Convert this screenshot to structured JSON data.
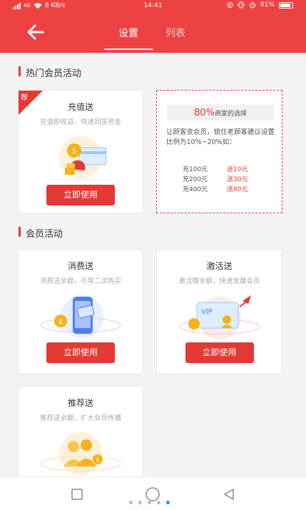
{
  "status_bar": {
    "signal": "4G",
    "speed": "8 KB/s",
    "time": "14:41",
    "battery": "81%"
  },
  "header": {
    "tabs": [
      {
        "label": "设置",
        "active": true
      },
      {
        "label": "列表",
        "active": false
      }
    ]
  },
  "sections": {
    "hot": {
      "title": "热门会员活动"
    },
    "member": {
      "title": "会员活动"
    }
  },
  "cards": {
    "recharge": {
      "ribbon": "荐",
      "title": "充值送",
      "desc": "充值即收益，快速回笼资金",
      "button": "立即使用"
    },
    "consume": {
      "title": "消费送",
      "desc": "消费送余额，引导二次购买",
      "button": "立即使用"
    },
    "activate": {
      "title": "激活送",
      "desc": "激活赠余额，快速发展会员",
      "button": "立即使用",
      "vip": "VIP"
    },
    "referral": {
      "title": "推荐送",
      "desc": "推荐送余额，扩大会员传播"
    }
  },
  "tip": {
    "percent": "80%",
    "headline_rest": "商家的选择",
    "body": "让顾客变会员，锁住老顾客建议设置比例为10%~20%如：",
    "rows": [
      {
        "recharge": "充100元",
        "gift": "送10元"
      },
      {
        "recharge": "充200元",
        "gift": "送30元"
      },
      {
        "recharge": "充400元",
        "gift": "送80元"
      }
    ]
  },
  "colors": {
    "brand": "#ee4242",
    "accent": "#e53935",
    "coin": "#f6b21b",
    "phone": "#4f7ff2"
  }
}
